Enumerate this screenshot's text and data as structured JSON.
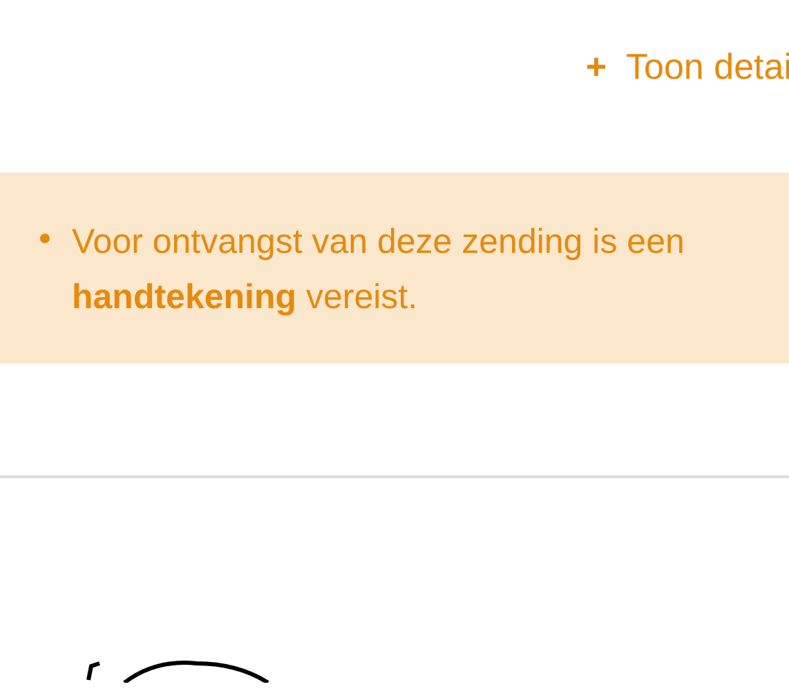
{
  "details_toggle": {
    "icon": "+",
    "label": "Toon detai"
  },
  "notice": {
    "items": [
      "Voor ontvangst van deze zending is een **handtekening** vereist."
    ]
  }
}
